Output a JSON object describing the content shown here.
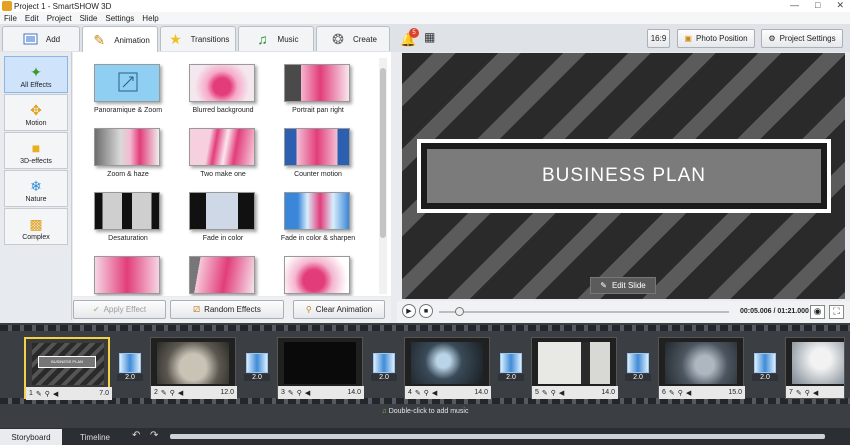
{
  "window": {
    "title": "Project 1 - SmartSHOW 3D"
  },
  "menu": [
    "File",
    "Edit",
    "Project",
    "Slide",
    "Settings",
    "Help"
  ],
  "tabs": [
    {
      "label": "Add",
      "icon": "add-media-icon"
    },
    {
      "label": "Animation",
      "icon": "animation-brush-icon"
    },
    {
      "label": "Transitions",
      "icon": "star-icon"
    },
    {
      "label": "Music",
      "icon": "music-note-icon"
    },
    {
      "label": "Create",
      "icon": "film-reel-icon"
    }
  ],
  "right_toolbar": {
    "notifications_count": "5",
    "aspect_ratio": "16:9",
    "photo_position": "Photo Position",
    "project_settings": "Project Settings"
  },
  "categories": [
    {
      "label": "All Effects",
      "icon": "all-effects-icon",
      "active": true
    },
    {
      "label": "Motion",
      "icon": "motion-icon"
    },
    {
      "label": "3D-effects",
      "icon": "cube-icon"
    },
    {
      "label": "Nature",
      "icon": "snowflake-icon"
    },
    {
      "label": "Complex",
      "icon": "complex-icon"
    }
  ],
  "effects": [
    {
      "label": "Panoramique & Zoom"
    },
    {
      "label": "Blurred background"
    },
    {
      "label": "Portrait pan right"
    },
    {
      "label": "Zoom & haze"
    },
    {
      "label": "Two make one"
    },
    {
      "label": "Counter motion"
    },
    {
      "label": "Desaturation"
    },
    {
      "label": "Fade in color"
    },
    {
      "label": "Fade in color & sharpen"
    },
    {
      "label": ""
    },
    {
      "label": ""
    },
    {
      "label": ""
    }
  ],
  "actions": {
    "apply": "Apply Effect",
    "random": "Random Effects",
    "clear": "Clear Animation"
  },
  "preview": {
    "slide_title": "BUSINESS PLAN",
    "edit_slide": "Edit Slide",
    "time": "00:05.006 / 01:21.000"
  },
  "slides": [
    {
      "num": "1",
      "duration": "7.0",
      "transition": "2.0"
    },
    {
      "num": "2",
      "duration": "12.0",
      "transition": "2.0"
    },
    {
      "num": "3",
      "duration": "14.0",
      "transition": "2.0"
    },
    {
      "num": "4",
      "duration": "14.0",
      "transition": "2.0"
    },
    {
      "num": "5",
      "duration": "14.0",
      "transition": "2.0"
    },
    {
      "num": "6",
      "duration": "15.0",
      "transition": "2.0"
    },
    {
      "num": "7",
      "duration": ""
    }
  ],
  "music_hint": "Double-click to add music",
  "bottom_tabs": [
    "Storyboard",
    "Timeline"
  ],
  "colors": {
    "accent": "#f2d24a",
    "selected_category": "#cfe4fa",
    "timeline_bg": "#3b3f44"
  }
}
